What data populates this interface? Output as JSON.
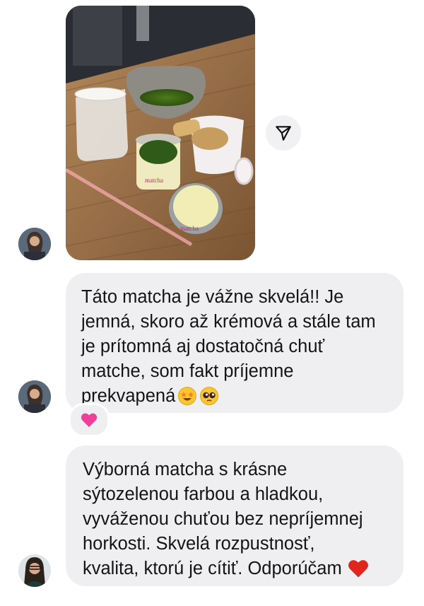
{
  "conversation": {
    "messages": [
      {
        "kind": "photo",
        "image": "matcha-set-photo",
        "photo_labels": {
          "tin": "matcha",
          "jar": "matcha"
        }
      },
      {
        "kind": "text",
        "text": "Táto matcha je vážne skvelá!! Je\njemná, skoro až krémová a stále tam\nje prítomná aj dostatočná chuť\nmatche, som fakt príjemne\nprekvapená",
        "trailing_emojis": [
          "star-struck-emoji",
          "pleading-face-emoji"
        ],
        "reaction": "pink-heart-emoji"
      },
      {
        "kind": "text",
        "text": "Výborná matcha s krásne\nsýtozelenou farbou a hladkou,\nvyváženou chuťou bez nepríjemnej\nhorkosti. Skvelá rozpustnosť,\nkvalita, ktorú je cítiť. Odporúčam",
        "trailing_emojis": [
          "red-heart-emoji"
        ]
      }
    ]
  },
  "icons": {
    "share": "paper-plane-icon"
  },
  "colors": {
    "bubble": "#efeff1",
    "share_button": "#f1f1f3",
    "text": "#141414",
    "pink_heart": "#ee3f9a",
    "red_heart": "#e0261f"
  }
}
